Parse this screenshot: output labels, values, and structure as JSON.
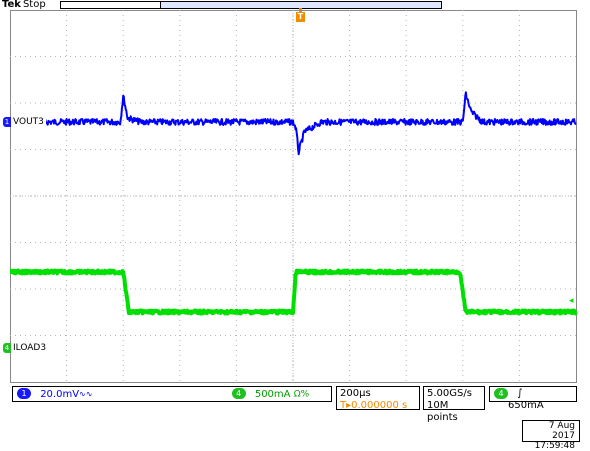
{
  "header": {
    "brand": "Tek",
    "run_state": "Stop"
  },
  "colors": {
    "ch1": "#0000ff",
    "ch4": "#00e000",
    "trigger": "#f08c00",
    "grid": "#b4b4b4"
  },
  "trigger_marker": {
    "label": "T"
  },
  "channels": {
    "ch1": {
      "number": "1",
      "name": "VOUT3",
      "scale": "20.0mV",
      "bw_symbol": "∿∿"
    },
    "ch4": {
      "number": "4",
      "name": "ILOAD3",
      "scale": "500mA",
      "extra": "Ω%"
    }
  },
  "timebase": {
    "scale": "200μs",
    "position_prefix": "T▸",
    "position": "0.000000 s"
  },
  "acquisition": {
    "sample_rate": "5.00GS/s",
    "record_length": "10M points"
  },
  "trigger": {
    "source": "4",
    "slope_symbol": "∫",
    "level": "650mA"
  },
  "timestamp": {
    "date": "7 Aug 2017",
    "time": "17:59:48"
  },
  "chart_data": {
    "type": "line",
    "title": "",
    "xlabel": "",
    "ylabel": "",
    "grid": true,
    "divisions": {
      "horizontal": 10,
      "vertical": 8
    },
    "series": [
      {
        "name": "VOUT3",
        "note": "noisy flat trace with transients at load steps",
        "x_div": [
          0,
          1.95,
          2.0,
          2.08,
          2.3,
          5.0,
          5.05,
          5.1,
          5.2,
          5.5,
          8.0,
          8.05,
          8.15,
          8.35,
          10.0
        ],
        "y_div": [
          0,
          0,
          0.65,
          0.1,
          0,
          0,
          -0.15,
          -0.75,
          -0.25,
          0,
          0,
          0.7,
          0.25,
          0,
          0
        ]
      },
      {
        "name": "ILOAD3",
        "x_div": [
          0,
          2.0,
          2.1,
          5.0,
          5.05,
          7.95,
          8.05,
          10.0
        ],
        "y_div": [
          0,
          0,
          -1.0,
          -1.0,
          0,
          0,
          -1.0,
          -1.0
        ]
      }
    ]
  }
}
